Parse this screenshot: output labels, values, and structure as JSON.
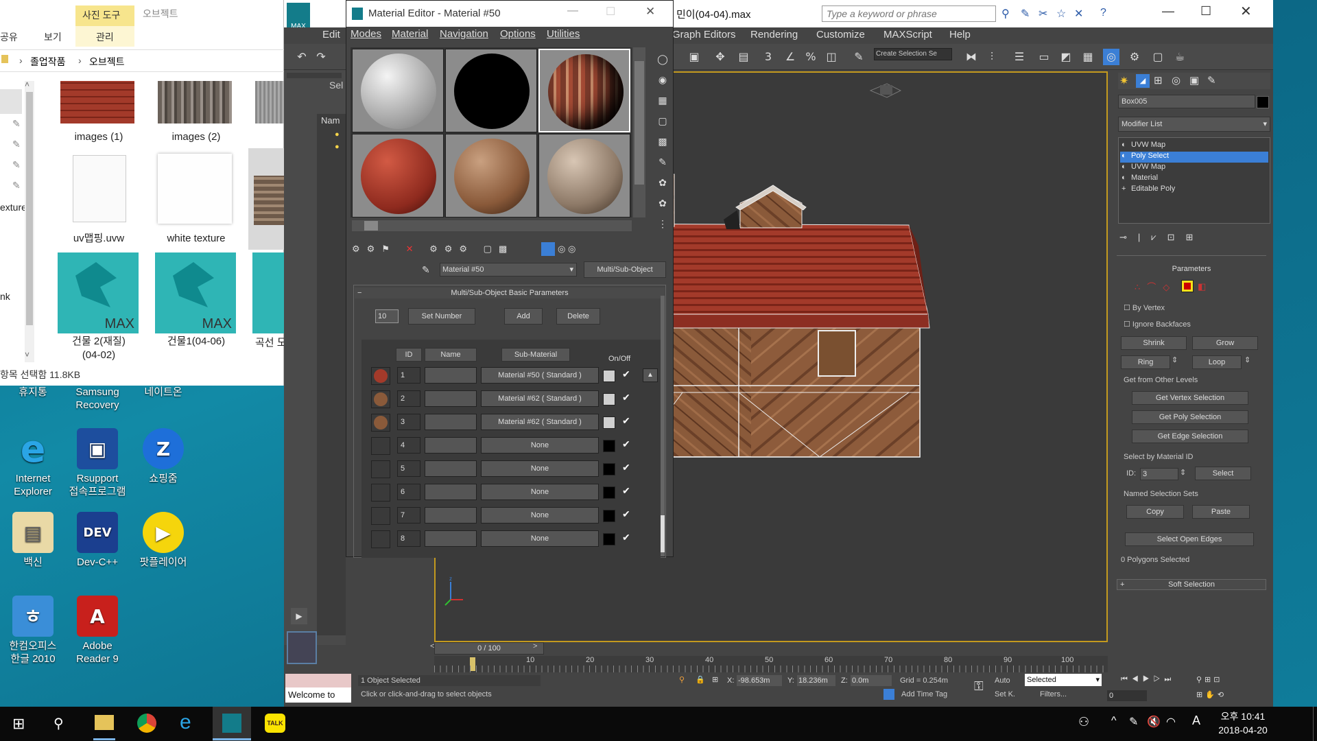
{
  "desktop": {
    "icons": [
      {
        "label": "휴지통",
        "sub": ""
      },
      {
        "label": "Samsung",
        "sub": "Recovery"
      },
      {
        "label": "네이트온",
        "sub": ""
      },
      {
        "label": "Internet",
        "sub": "Explorer"
      },
      {
        "label": "Rsupport",
        "sub": "접속프로그램"
      },
      {
        "label": "쇼핑줌",
        "sub": ""
      },
      {
        "label": "백신",
        "sub": ""
      },
      {
        "label": "Dev-C++",
        "sub": ""
      },
      {
        "label": "팟플레이어",
        "sub": ""
      },
      {
        "label": "한컴오피스",
        "sub": "한글 2010"
      },
      {
        "label": "Adobe",
        "sub": "Reader 9"
      }
    ]
  },
  "explorer": {
    "ribbon_tab_active": "사진 도구",
    "ribbon_tab_2": "오브젝트",
    "tab_share": "공유",
    "tab_view": "보기",
    "tab_manage": "관리",
    "breadcrumb_1": "졸업작품",
    "breadcrumb_2": "오브젝트",
    "files": [
      {
        "name": "images (1)"
      },
      {
        "name": "images (2)"
      },
      {
        "name": "uv맵핑.uvw"
      },
      {
        "name": "white texture"
      },
      {
        "name": "건물 2(재질)",
        "sub": "(04-02)"
      },
      {
        "name": "건물1(04-06)"
      },
      {
        "name": "곡선 도"
      }
    ],
    "max_badge": "MAX",
    "status": "항목 선택함 11.8KB",
    "side_text_1": "exture",
    "side_text_2": "nk"
  },
  "max": {
    "title": "민이(04-04).max",
    "search_placeholder": "Type a keyword or phrase",
    "menu": [
      "Edit",
      "Graph Editors",
      "Rendering",
      "Customize",
      "MAXScript",
      "Help"
    ],
    "create_selection": "Create Selection Se",
    "side_sel": "Sel",
    "side_name": "Nam",
    "viewport_label": "",
    "object_name": "Box005",
    "modifier_list": "Modifier List",
    "stack": [
      "UVW Map",
      "Poly Select",
      "UVW Map",
      "Material",
      "Editable Poly"
    ],
    "parameters": "Parameters",
    "by_vertex": "By Vertex",
    "ignore_backfaces": "Ignore Backfaces",
    "shrink": "Shrink",
    "grow": "Grow",
    "ring": "Ring",
    "loop": "Loop",
    "get_from_other": "Get from Other Levels",
    "get_vertex": "Get Vertex Selection",
    "get_poly": "Get Poly Selection",
    "get_edge": "Get Edge Selection",
    "select_by_mat": "Select by Material ID",
    "id_label": "ID:",
    "id_value": "3",
    "select_btn": "Select",
    "named_sel": "Named Selection Sets",
    "copy": "Copy",
    "paste": "Paste",
    "select_open_edges": "Select Open Edges",
    "polys_selected": "0 Polygons Selected",
    "soft_selection": "Soft Selection",
    "time_slider": "0 / 100",
    "ticks": [
      "10",
      "20",
      "30",
      "40",
      "50",
      "60",
      "70",
      "80",
      "90",
      "100"
    ],
    "status_selected": "1 Object Selected",
    "status_hint": "Click or click-and-drag to select objects",
    "welcome": "Welcome to",
    "x_label": "X:",
    "x_val": "-98.653m",
    "y_label": "Y:",
    "y_val": "18.236m",
    "z_label": "Z:",
    "z_val": "0.0m",
    "grid": "Grid = 0.254m",
    "auto": "Auto",
    "setk": "Set K.",
    "selected_dd": "Selected",
    "filters": "Filters...",
    "add_time_tag": "Add Time Tag",
    "frame": "0"
  },
  "mated": {
    "title": "Material Editor - Material #50",
    "menu": [
      "Modes",
      "Material",
      "Navigation",
      "Options",
      "Utilities"
    ],
    "material_name": "Material #50",
    "type_btn": "Multi/Sub-Object",
    "rollout": "Multi/Sub-Object Basic Parameters",
    "count": "10",
    "set_number": "Set Number",
    "add": "Add",
    "delete": "Delete",
    "col_id": "ID",
    "col_name": "Name",
    "col_sub": "Sub-Material",
    "col_onoff": "On/Off",
    "rows": [
      {
        "id": "1",
        "sub": "Material #50  ( Standard )",
        "color": "#d0d0d0",
        "ball": true
      },
      {
        "id": "2",
        "sub": "Material #62  ( Standard )",
        "color": "#d0d0d0",
        "ball": true
      },
      {
        "id": "3",
        "sub": "Material #62  ( Standard )",
        "color": "#d0d0d0",
        "ball": true
      },
      {
        "id": "4",
        "sub": "None",
        "color": "#000000",
        "ball": false
      },
      {
        "id": "5",
        "sub": "None",
        "color": "#000000",
        "ball": false
      },
      {
        "id": "6",
        "sub": "None",
        "color": "#000000",
        "ball": false
      },
      {
        "id": "7",
        "sub": "None",
        "color": "#000000",
        "ball": false
      },
      {
        "id": "8",
        "sub": "None",
        "color": "#000000",
        "ball": false
      }
    ]
  },
  "taskbar": {
    "time": "오후 10:41",
    "date": "2018-04-20",
    "ime": "A"
  },
  "colors": {
    "accent": "#c49a1e",
    "selection": "#3b7fd6",
    "roof": "#a33a2a",
    "wood": "#8a5a3a"
  }
}
